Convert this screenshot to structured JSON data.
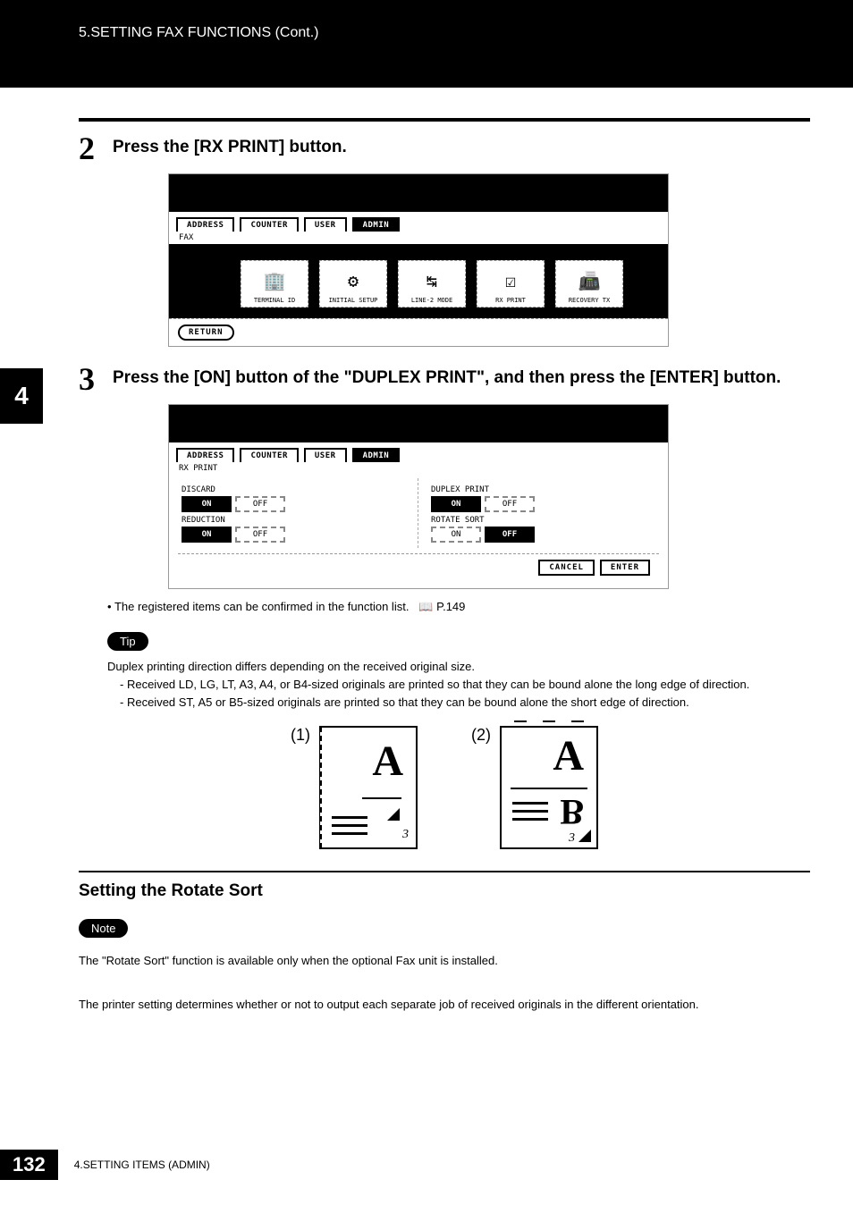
{
  "header": {
    "chapter": "5.SETTING FAX FUNCTIONS (Cont.)"
  },
  "side_tab": "4",
  "steps": [
    {
      "num": "2",
      "text": "Press the [RX PRINT] button."
    },
    {
      "num": "3",
      "text": "Press the [ON] button of the \"DUPLEX PRINT\", and then press the [ENTER] button."
    }
  ],
  "screenshot1": {
    "tabs": [
      "ADDRESS",
      "COUNTER",
      "USER",
      "ADMIN"
    ],
    "active_tab_index": 3,
    "sub_label": "FAX",
    "buttons": [
      "TERMINAL ID",
      "INITIAL SETUP",
      "LINE-2 MODE",
      "RX PRINT",
      "RECOVERY TX"
    ],
    "back_button": "RETURN"
  },
  "screenshot2": {
    "tabs": [
      "ADDRESS",
      "COUNTER",
      "USER",
      "ADMIN"
    ],
    "active_tab_index": 3,
    "sub_label": "RX PRINT",
    "left": [
      {
        "label": "DISCARD",
        "on": true,
        "off_label": "OFF",
        "on_label": "ON"
      },
      {
        "label": "REDUCTION",
        "on": true,
        "off_label": "OFF",
        "on_label": "ON"
      }
    ],
    "right": [
      {
        "label": "DUPLEX PRINT",
        "on": true,
        "dotted": true,
        "off_label": "OFF",
        "on_label": "ON"
      },
      {
        "label": "ROTATE SORT",
        "on": false,
        "off_active": true,
        "off_label": "OFF",
        "on_label": "ON"
      }
    ],
    "actions": {
      "cancel": "CANCEL",
      "enter": "ENTER"
    }
  },
  "bullet_note": "The registered items can be confirmed in the function list.",
  "bullet_ref": "P.149",
  "tip": {
    "badge": "Tip",
    "intro": "Duplex printing direction differs depending on the received original size.",
    "items": [
      "Received LD, LG, LT, A3, A4, or B4-sized originals are printed so that they can be bound alone the long edge of direction.",
      "Received ST, A5 or B5-sized originals are printed so that they can be bound alone the short edge of direction."
    ]
  },
  "diagrams": {
    "labels": [
      "(1)",
      "(2)"
    ]
  },
  "section": {
    "heading": "Setting the Rotate Sort",
    "note_badge": "Note",
    "note_text": "The \"Rotate Sort\" function is available only when the optional Fax unit is installed.",
    "desc": "The printer setting determines whether or not to output each separate job of received originals in the different orientation."
  },
  "footer": {
    "page": "132",
    "text": "4.SETTING ITEMS (ADMIN)"
  }
}
